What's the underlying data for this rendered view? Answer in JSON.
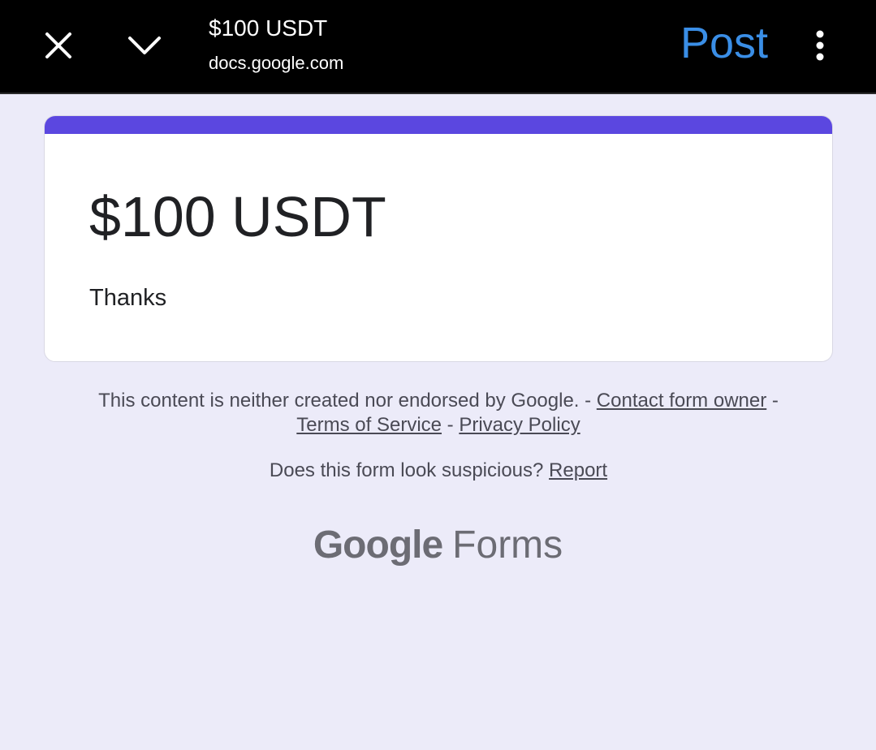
{
  "topbar": {
    "title": "$100 USDT",
    "domain": "docs.google.com",
    "post_label": "Post",
    "close_icon": "close-icon",
    "chevron_icon": "chevron-down-icon",
    "more_icon": "more-vert-icon",
    "post_color": "#3a8ee6"
  },
  "form": {
    "title": "$100 USDT",
    "description": "Thanks",
    "accent_color": "#5b47e0"
  },
  "footer": {
    "disclaimer_text": "This content is neither created nor endorsed by Google. - ",
    "contact_link": "Contact form owner",
    "sep1": " - ",
    "terms_link": "Terms of Service",
    "sep2": " - ",
    "privacy_link": "Privacy Policy",
    "suspicious_text": "Does this form look suspicious? ",
    "report_link": "Report"
  },
  "brand": {
    "google": "Google",
    "forms": "Forms"
  }
}
